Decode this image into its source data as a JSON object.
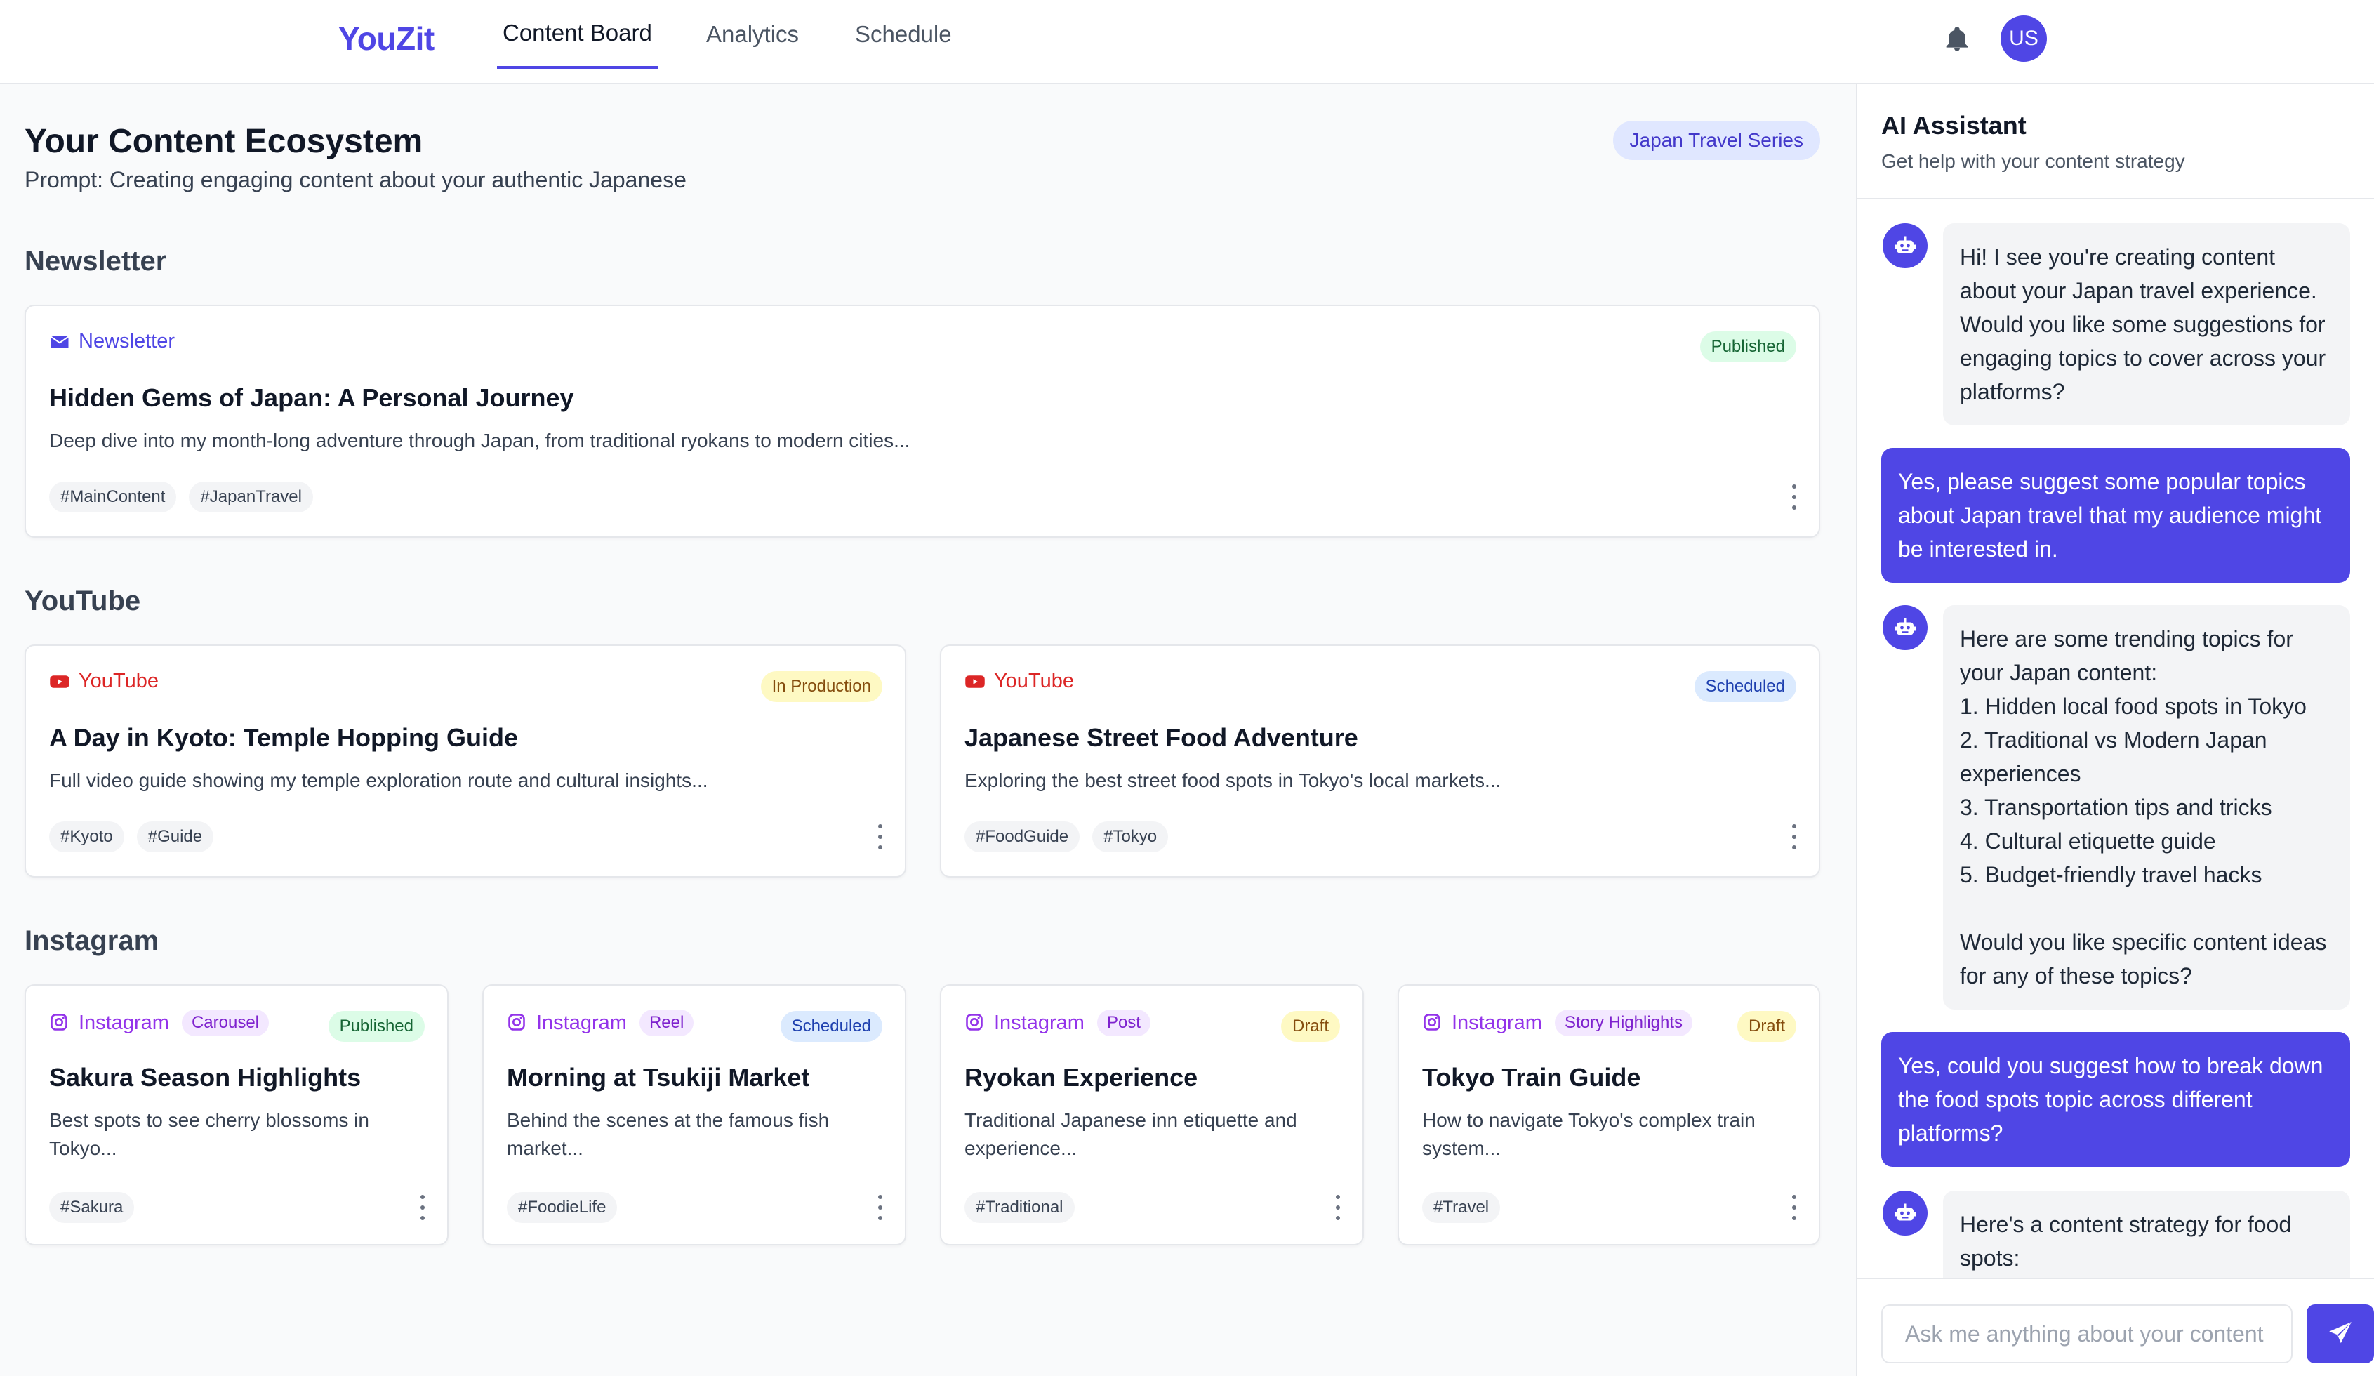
{
  "app": {
    "brand": "YouZit",
    "user_initials": "US"
  },
  "nav": {
    "tabs": [
      {
        "label": "Content Board",
        "active": true
      },
      {
        "label": "Analytics",
        "active": false
      },
      {
        "label": "Schedule",
        "active": false
      }
    ]
  },
  "board": {
    "title": "Your Content Ecosystem",
    "prompt": "Prompt: Creating engaging content about your authentic Japanese",
    "series": "Japan Travel Series",
    "sections": {
      "newsletter": "Newsletter",
      "youtube": "YouTube",
      "instagram": "Instagram"
    },
    "cards": {
      "newsletter": [
        {
          "platform": "Newsletter",
          "status": "Published",
          "title": "Hidden Gems of Japan: A Personal Journey",
          "desc": "Deep dive into my month-long adventure through Japan, from traditional ryokans to modern cities...",
          "tags": [
            "#MainContent",
            "#JapanTravel"
          ]
        }
      ],
      "youtube": [
        {
          "platform": "YouTube",
          "status": "In Production",
          "title": "A Day in Kyoto: Temple Hopping Guide",
          "desc": "Full video guide showing my temple exploration route and cultural insights...",
          "tags": [
            "#Kyoto",
            "#Guide"
          ]
        },
        {
          "platform": "YouTube",
          "status": "Scheduled",
          "title": "Japanese Street Food Adventure",
          "desc": "Exploring the best street food spots in Tokyo's local markets...",
          "tags": [
            "#FoodGuide",
            "#Tokyo"
          ]
        }
      ],
      "instagram": [
        {
          "platform": "Instagram",
          "format": "Carousel",
          "status": "Published",
          "title": "Sakura Season Highlights",
          "desc": "Best spots to see cherry blossoms in Tokyo...",
          "tags": [
            "#Sakura"
          ]
        },
        {
          "platform": "Instagram",
          "format": "Reel",
          "status": "Scheduled",
          "title": "Morning at Tsukiji Market",
          "desc": "Behind the scenes at the famous fish market...",
          "tags": [
            "#FoodieLife"
          ]
        },
        {
          "platform": "Instagram",
          "format": "Post",
          "status": "Draft",
          "title": "Ryokan Experience",
          "desc": "Traditional Japanese inn etiquette and experience...",
          "tags": [
            "#Traditional"
          ]
        },
        {
          "platform": "Instagram",
          "format": "Story Highlights",
          "status": "Draft",
          "title": "Tokyo Train Guide",
          "desc": "How to navigate Tokyo's complex train system...",
          "tags": [
            "#Travel"
          ]
        }
      ]
    }
  },
  "assistant": {
    "title": "AI Assistant",
    "subtitle": "Get help with your content strategy",
    "messages": [
      {
        "role": "bot",
        "text": "Hi! I see you're creating content about your Japan travel experience. Would you like some suggestions for engaging topics to cover across your platforms?"
      },
      {
        "role": "user",
        "text": "Yes, please suggest some popular topics about Japan travel that my audience might be interested in."
      },
      {
        "role": "bot",
        "text": "Here are some trending topics for your Japan content:\n1. Hidden local food spots in Tokyo\n2. Traditional vs Modern Japan experiences\n3. Transportation tips and tricks\n4. Cultural etiquette guide\n5. Budget-friendly travel hacks\n\nWould you like specific content ideas for any of these topics?"
      },
      {
        "role": "user",
        "text": "Yes, could you suggest how to break down the food spots topic across different platforms?"
      },
      {
        "role": "bot",
        "text": "Here's a content strategy for food spots:"
      }
    ],
    "input_placeholder": "Ask me anything about your content"
  },
  "colors": {
    "accent": "#4f46e5",
    "newsletter": "#4f46e5",
    "youtube": "#dc2626",
    "instagram": "#9333ea",
    "status_published_bg": "#dcfce7",
    "status_published_fg": "#166534",
    "status_production_bg": "#fef9c3",
    "status_production_fg": "#854d0e",
    "status_scheduled_bg": "#dbeafe",
    "status_scheduled_fg": "#1e40af",
    "status_draft_bg": "#fef9c3",
    "status_draft_fg": "#854d0e"
  },
  "icons": {
    "notifications": "bell-icon",
    "newsletter": "mail-icon",
    "youtube": "youtube-icon",
    "instagram": "instagram-icon",
    "menu": "more-vertical-icon",
    "bot": "robot-icon",
    "send": "send-icon"
  }
}
